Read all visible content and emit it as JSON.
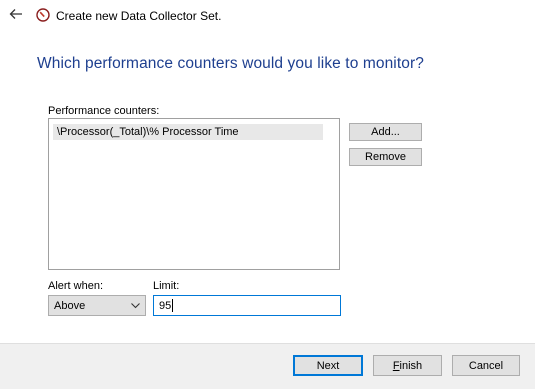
{
  "window": {
    "title": "Create new Data Collector Set."
  },
  "page": {
    "heading": "Which performance counters would you like to monitor?"
  },
  "counters": {
    "label": "Performance counters:",
    "items": [
      "\\Processor(_Total)\\% Processor Time"
    ],
    "add_label": "Add...",
    "remove_label": "Remove"
  },
  "alert": {
    "label": "Alert when:",
    "selected": "Above"
  },
  "limit": {
    "label": "Limit:",
    "value": "95"
  },
  "footer": {
    "next_label": "Next",
    "finish_first": "F",
    "finish_rest": "inish",
    "cancel_label": "Cancel"
  },
  "colors": {
    "heading": "#1e3f8f",
    "focus": "#0078d7",
    "icon_red": "#c0392b"
  },
  "icons": [
    "back-arrow-icon",
    "data-collector-icon",
    "chevron-down-icon"
  ]
}
